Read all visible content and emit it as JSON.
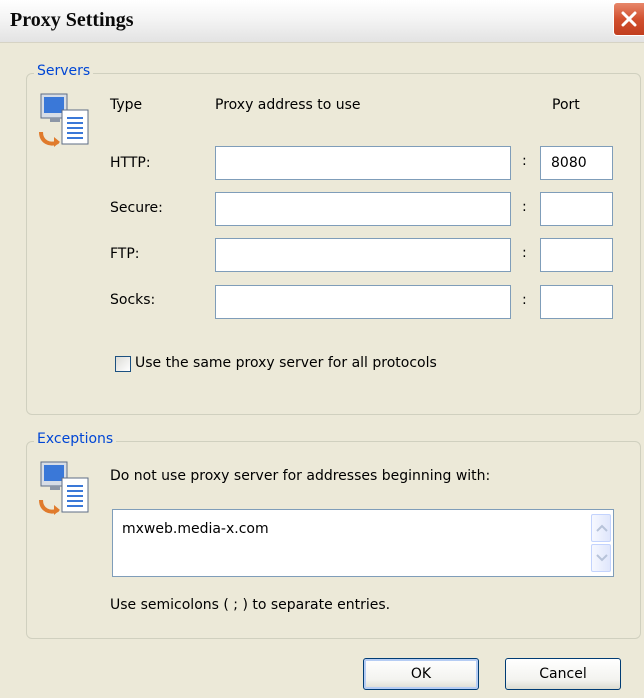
{
  "window": {
    "title": "Proxy Settings"
  },
  "servers": {
    "legend": "Servers",
    "icon": "network-computer-icon",
    "headers": {
      "type": "Type",
      "address": "Proxy address to use",
      "port": "Port"
    },
    "rows": [
      {
        "label": "HTTP:",
        "address": "",
        "colon": ":",
        "port": "8080"
      },
      {
        "label": "Secure:",
        "address": "",
        "colon": ":",
        "port": ""
      },
      {
        "label": "FTP:",
        "address": "",
        "colon": ":",
        "port": ""
      },
      {
        "label": "Socks:",
        "address": "",
        "colon": ":",
        "port": ""
      }
    ],
    "same_proxy": {
      "label": "Use the same proxy server for all protocols",
      "checked": false
    }
  },
  "exceptions": {
    "legend": "Exceptions",
    "icon": "network-computer-icon",
    "description": "Do not use proxy server for addresses beginning with:",
    "value": "mxweb.media-x.com",
    "hint": "Use semicolons ( ; ) to separate entries."
  },
  "buttons": {
    "ok": "OK",
    "cancel": "Cancel"
  },
  "colors": {
    "legend": "#0046d5",
    "background": "#ece9d8",
    "close": "#d2502f"
  }
}
